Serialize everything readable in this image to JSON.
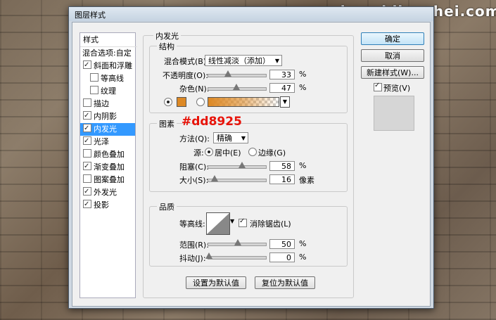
{
  "watermark": "www.haoyidianshei.com",
  "dialog": {
    "title": "图层样式"
  },
  "style_list": {
    "header": "样式",
    "blending_options": "混合选项:自定",
    "items": [
      {
        "label": "斜面和浮雕",
        "checked": true
      },
      {
        "label": "等高线",
        "checked": false
      },
      {
        "label": "纹理",
        "checked": false
      },
      {
        "label": "描边",
        "checked": false
      },
      {
        "label": "内阴影",
        "checked": true
      },
      {
        "label": "内发光",
        "checked": true,
        "selected": true
      },
      {
        "label": "光泽",
        "checked": true
      },
      {
        "label": "颜色叠加",
        "checked": false
      },
      {
        "label": "渐变叠加",
        "checked": true
      },
      {
        "label": "图案叠加",
        "checked": false
      },
      {
        "label": "外发光",
        "checked": true
      },
      {
        "label": "投影",
        "checked": true
      }
    ]
  },
  "inner_glow": {
    "title": "内发光",
    "structure": {
      "legend": "结构",
      "blend_mode_label": "混合模式(B):",
      "blend_mode_value": "线性减淡（添加）",
      "opacity_label": "不透明度(O):",
      "opacity_value": "33",
      "opacity_unit": "%",
      "noise_label": "杂色(N):",
      "noise_value": "47",
      "noise_unit": "%",
      "color_hex": "#dd8925",
      "annotation": "#dd8925"
    },
    "elements": {
      "legend": "图素",
      "technique_label": "方法(Q):",
      "technique_value": "精确",
      "source_label": "源:",
      "source_center": "居中(E)",
      "source_edge": "边缘(G)",
      "choke_label": "阻塞(C):",
      "choke_value": "58",
      "choke_unit": "%",
      "size_label": "大小(S):",
      "size_value": "16",
      "size_unit": "像素"
    },
    "quality": {
      "legend": "品质",
      "contour_label": "等高线:",
      "antialias_label": "消除锯齿(L)",
      "range_label": "范围(R):",
      "range_value": "50",
      "range_unit": "%",
      "jitter_label": "抖动(J):",
      "jitter_value": "0",
      "jitter_unit": "%"
    },
    "make_default": "设置为默认值",
    "reset_default": "复位为默认值"
  },
  "buttons": {
    "ok": "确定",
    "cancel": "取消",
    "new_style": "新建样式(W)...",
    "preview_label": "预览(V)"
  }
}
